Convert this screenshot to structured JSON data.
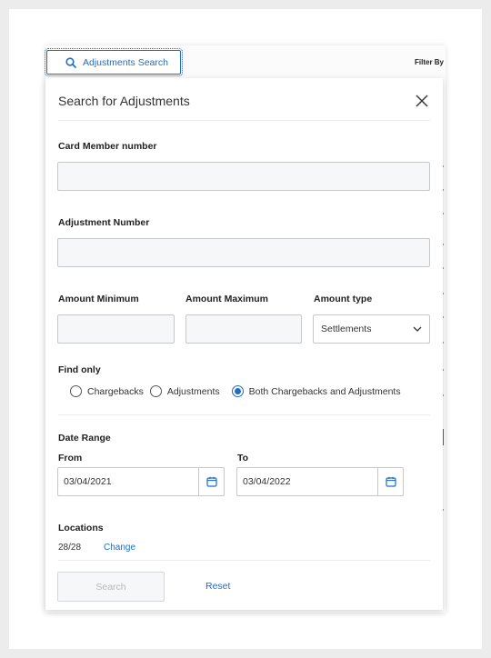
{
  "toolbar": {
    "search_tab_label": "Adjustments Search",
    "filter_by_label": "Filter By"
  },
  "modal": {
    "title": "Search for Adjustments",
    "card_member_label": "Card Member number",
    "card_member_value": "",
    "adjustment_number_label": "Adjustment Number",
    "adjustment_number_value": "",
    "amount_minimum_label": "Amount Minimum",
    "amount_minimum_value": "",
    "amount_maximum_label": "Amount Maximum",
    "amount_maximum_value": "",
    "amount_type_label": "Amount type",
    "amount_type_value": "Settlements",
    "find_only_label": "Find only",
    "find_only_options": [
      {
        "label": "Chargebacks",
        "selected": false
      },
      {
        "label": "Adjustments",
        "selected": false
      },
      {
        "label": "Both Chargebacks and Adjustments",
        "selected": true
      }
    ],
    "date_range_label": "Date Range",
    "from_label": "From",
    "from_value": "03/04/2021",
    "to_label": "To",
    "to_value": "03/04/2022",
    "locations_label": "Locations",
    "locations_count": "28/28",
    "change_link": "Change",
    "search_button": "Search",
    "search_disabled": true,
    "reset_button": "Reset"
  },
  "colors": {
    "accent": "#1d6cc8",
    "input_fill": "#f6f7f8",
    "border": "#c8c8c8",
    "disabled_text": "#b8b8b8"
  },
  "icons": [
    "search-icon",
    "close-icon",
    "chevron-down-icon",
    "calendar-icon"
  ]
}
